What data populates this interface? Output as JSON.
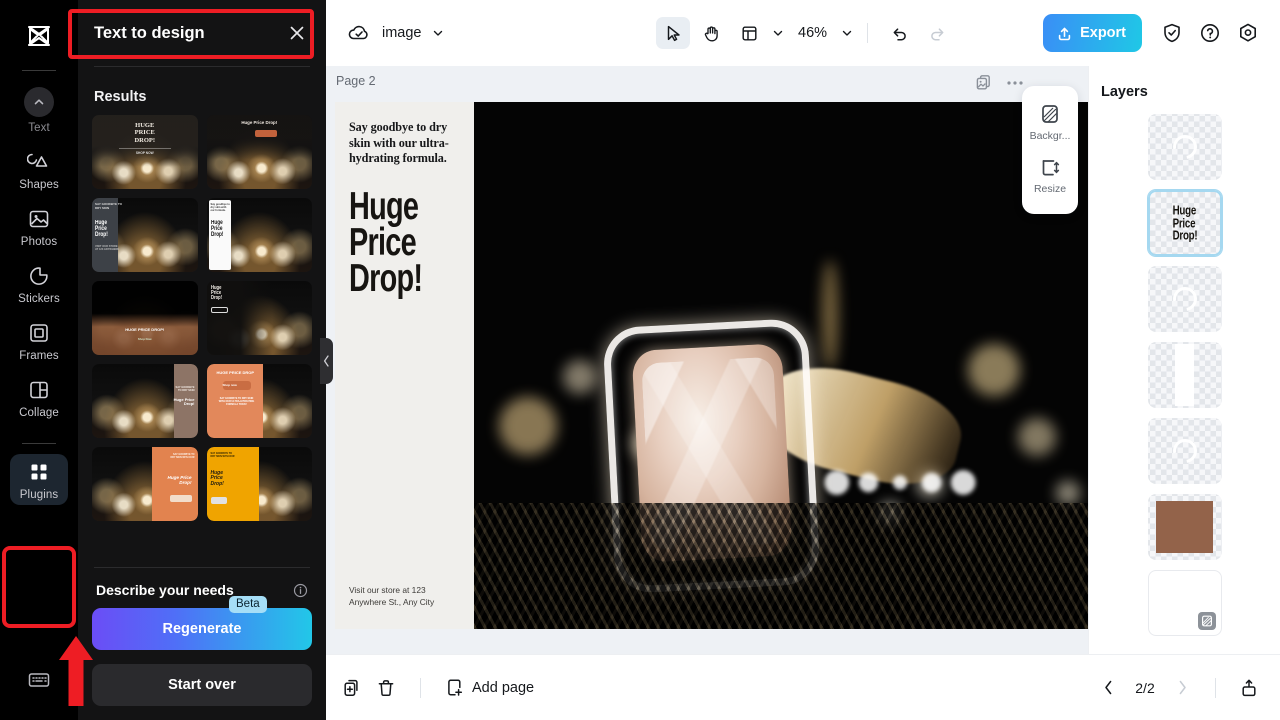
{
  "app": {
    "logo_icon": "capcut-logo-icon"
  },
  "sidebar": {
    "items": [
      {
        "label": "Text",
        "icon": "chevron-up-circle-icon",
        "active": false
      },
      {
        "label": "Shapes",
        "icon": "shapes-icon",
        "active": false
      },
      {
        "label": "Photos",
        "icon": "photo-icon",
        "active": false
      },
      {
        "label": "Stickers",
        "icon": "sticker-icon",
        "active": false
      },
      {
        "label": "Frames",
        "icon": "frame-icon",
        "active": false
      },
      {
        "label": "Collage",
        "icon": "collage-icon",
        "active": false
      },
      {
        "label": "Plugins",
        "icon": "plugins-grid-icon",
        "active": true
      }
    ],
    "bottom_item": {
      "label": "",
      "icon": "keyboard-icon"
    }
  },
  "panel": {
    "title": "Text to design",
    "close_icon": "close-icon",
    "results_label": "Results",
    "thumbnails": [
      {
        "id": "thumb-1",
        "style": "dark-serif-top",
        "text": "HUGE PRICE DROP!"
      },
      {
        "id": "thumb-2",
        "style": "dark-small-top",
        "text": "Huge Price Drop!"
      },
      {
        "id": "thumb-3",
        "style": "slate-left-panel",
        "text": "Huge Price Drop!"
      },
      {
        "id": "thumb-4",
        "style": "white-left-panel",
        "text": "Huge Price Drop!"
      },
      {
        "id": "thumb-5",
        "style": "brown-bottom-band",
        "text": "Huge Price Drop!"
      },
      {
        "id": "thumb-6",
        "style": "dark-left-text",
        "text": "Huge Price Drop!"
      },
      {
        "id": "thumb-7",
        "style": "taupe-right-panel",
        "text": "Huge Price Drop!"
      },
      {
        "id": "thumb-8",
        "style": "orange-left-panel",
        "text": "HUGE PRICE DROP"
      },
      {
        "id": "thumb-9",
        "style": "orange-right-wave",
        "text": "Huge Price Drop!"
      },
      {
        "id": "thumb-10",
        "style": "yellow-left-wave",
        "text": "Huge Price Drop!"
      }
    ],
    "needs_label": "Describe your needs",
    "info_icon": "info-icon",
    "beta_badge": "Beta",
    "regenerate_label": "Regenerate",
    "start_over_label": "Start over",
    "collapse_icon": "chevron-left-icon"
  },
  "toolbar": {
    "cloud_icon": "cloud-saved-icon",
    "doc_title": "image",
    "doc_chevron_icon": "chevron-down-icon",
    "select_tool_icon": "cursor-arrow-icon",
    "hand_tool_icon": "hand-icon",
    "layout_tool_icon": "layout-icon",
    "layout_chevron_icon": "chevron-down-icon",
    "zoom_level": "46%",
    "zoom_chevron_icon": "chevron-down-icon",
    "undo_icon": "undo-icon",
    "redo_icon": "redo-icon",
    "export_label": "Export",
    "export_icon": "upload-icon",
    "shield_icon": "shield-check-icon",
    "help_icon": "question-circle-icon",
    "settings_icon": "hexagon-settings-icon"
  },
  "canvas": {
    "page_label": "Page 2",
    "duplicate_page_icon": "duplicate-page-icon",
    "more_icon": "more-options-icon",
    "design": {
      "subheading": "Say goodbye to dry skin with our ultra-hydrating formula.",
      "headline": "Huge\nPrice\nDrop!",
      "footer": "Visit our store at 123\nAnywhere St., Any City",
      "photo_alt": "close-up of a diamond ring with golden bokeh"
    },
    "float_tools": [
      {
        "label": "Backgr...",
        "icon": "background-icon"
      },
      {
        "label": "Resize",
        "icon": "resize-icon"
      }
    ]
  },
  "layers": {
    "title": "Layers",
    "items": [
      {
        "id": "layer-1",
        "kind": "spinner",
        "selected": false,
        "text": ""
      },
      {
        "id": "layer-2",
        "kind": "text",
        "selected": true,
        "text": "Huge\nPrice\nDrop!"
      },
      {
        "id": "layer-3",
        "kind": "spinner",
        "selected": false,
        "text": ""
      },
      {
        "id": "layer-4",
        "kind": "white-strip",
        "selected": false,
        "text": ""
      },
      {
        "id": "layer-5",
        "kind": "spinner",
        "selected": false,
        "text": ""
      },
      {
        "id": "layer-6",
        "kind": "brown",
        "selected": false,
        "text": ""
      },
      {
        "id": "layer-7",
        "kind": "background",
        "selected": false,
        "text": ""
      }
    ]
  },
  "bottombar": {
    "duplicate_icon": "duplicate-icon",
    "delete_icon": "trash-icon",
    "add_page_label": "Add page",
    "add_page_icon": "add-page-icon",
    "prev_icon": "chevron-left-icon",
    "page_indicator": "2/2",
    "next_icon": "chevron-right-icon",
    "present_icon": "present-icon"
  },
  "annotations": {
    "highlight_color": "#ee1d24",
    "boxes": [
      {
        "target": "panel-title-bar"
      },
      {
        "target": "sidebar-item-plugins"
      }
    ],
    "arrow": {
      "target": "sidebar-item-plugins",
      "direction": "up"
    }
  },
  "colors": {
    "accent_export": "#1fc8e6",
    "accent_regenerate": "#6b4df6",
    "panel_bg": "#131314",
    "canvas_bg": "#eef1f5",
    "annotation_red": "#ee1d24",
    "layer_selected": "#a5d8f0"
  }
}
